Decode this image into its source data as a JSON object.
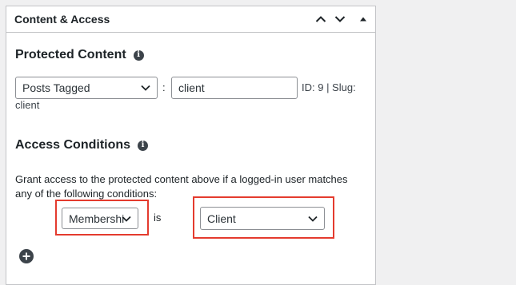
{
  "panel": {
    "title": "Content & Access",
    "controls": {
      "move_up": "chevron-up",
      "move_down": "chevron-down",
      "toggle": "triangle-up"
    }
  },
  "protected_content": {
    "heading": "Protected Content",
    "type_select": {
      "value": "Posts Tagged"
    },
    "separator": ":",
    "term_input": {
      "value": "client"
    },
    "meta_line1": "ID: 9 | Slug:",
    "meta_line2": "client"
  },
  "access_conditions": {
    "heading": "Access Conditions",
    "description": "Grant access to the protected content above if a logged-in user matches any of the following conditions:",
    "condition": {
      "field_select": {
        "value": "Membershi"
      },
      "operator": "is",
      "value_select": {
        "value": "Client"
      }
    }
  },
  "colors": {
    "highlight": "#e43b2e",
    "panel_border": "#c3c4c7",
    "page_background": "#f0f0f1"
  }
}
